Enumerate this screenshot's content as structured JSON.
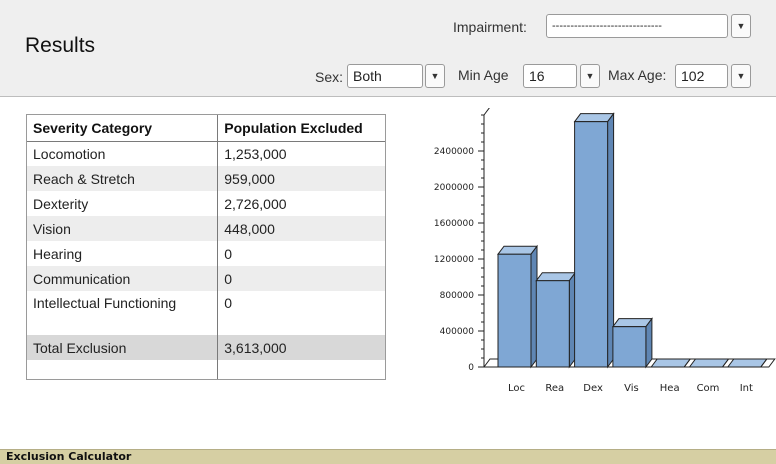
{
  "header": {
    "title": "Results",
    "impairment": {
      "label": "Impairment:",
      "value": "------------------------------"
    },
    "sex": {
      "label": "Sex:",
      "value": "Both"
    },
    "min_age": {
      "label": "Min Age",
      "value": "16"
    },
    "max_age": {
      "label": "Max Age:",
      "value": "102"
    }
  },
  "table": {
    "headers": [
      "Severity Category",
      "Population Excluded"
    ],
    "rows": [
      [
        "Locomotion",
        "1,253,000"
      ],
      [
        "Reach & Stretch",
        "959,000"
      ],
      [
        "Dexterity",
        "2,726,000"
      ],
      [
        "Vision",
        "448,000"
      ],
      [
        "Hearing",
        "0"
      ],
      [
        "Communication",
        "0"
      ],
      [
        "Intellectual Functioning",
        "0"
      ]
    ],
    "total": [
      "Total Exclusion",
      "3,613,000"
    ]
  },
  "chart_data": {
    "type": "bar",
    "categories": [
      "Loc",
      "Rea",
      "Dex",
      "Vis",
      "Hea",
      "Com",
      "Int"
    ],
    "values": [
      1253000,
      959000,
      2726000,
      448000,
      0,
      0,
      0
    ],
    "yticks": [
      0,
      400000,
      800000,
      1200000,
      1600000,
      2000000,
      2400000
    ],
    "ylim": [
      0,
      2800000
    ],
    "bar_color": "#7fa7d4",
    "grid": false,
    "style": "3d"
  },
  "status_bar": {
    "text": "Exclusion Calculator"
  }
}
